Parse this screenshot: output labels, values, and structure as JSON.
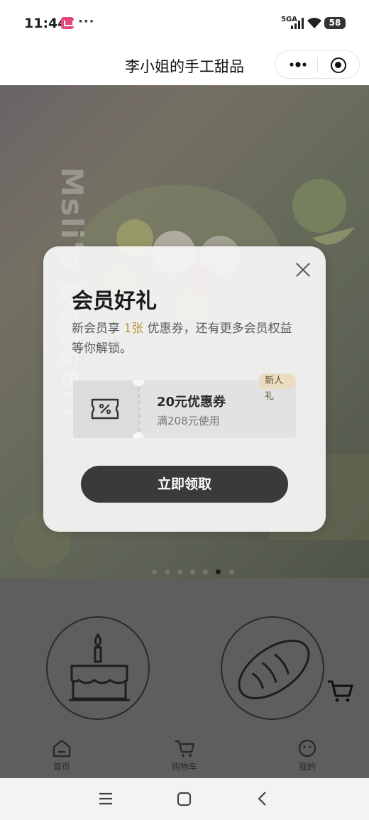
{
  "status_bar": {
    "time": "11:44",
    "more": "···",
    "network": "5GA",
    "battery": "58"
  },
  "title_bar": {
    "title": "李小姐的手工甜品",
    "more_icon": "more-dots-icon",
    "close_icon": "target-icon"
  },
  "banner": {
    "brand_text": "Msli's Dessert",
    "dots_total": 7,
    "active_dot": 6
  },
  "modal": {
    "title": "会员好礼",
    "desc_prefix": "新会员享 ",
    "desc_highlight": "1张",
    "desc_suffix": " 优惠券，还有更多会员权益等你解锁。",
    "coupon": {
      "name": "20元优惠券",
      "condition": "满208元使用",
      "tag": "新人礼",
      "icon": "coupon-percent-icon"
    },
    "claim_label": "立即领取"
  },
  "tab_bar": {
    "items": [
      {
        "label": "首页",
        "icon": "home-icon"
      },
      {
        "label": "购物车",
        "icon": "cart-icon"
      },
      {
        "label": "我的",
        "icon": "smile-icon"
      }
    ]
  },
  "colors": {
    "highlight": "#b8963c",
    "button": "#3a3a3a",
    "tag_bg": "#e9dcc0"
  }
}
